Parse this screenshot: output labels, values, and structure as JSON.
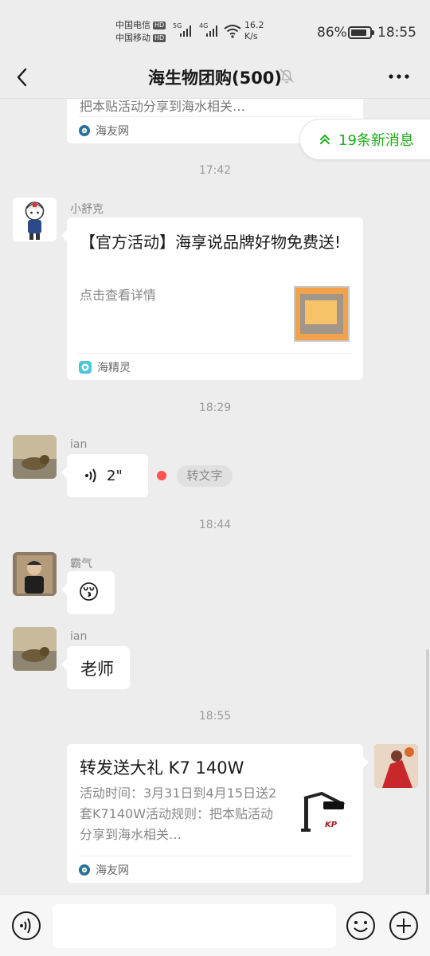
{
  "status_bar": {
    "carrier1": "中国电信",
    "carrier2": "中国移动",
    "hd_badge": "HD",
    "net1": "5G",
    "net2": "4G",
    "speed_value": "16.2",
    "speed_unit": "K/s",
    "battery_percent": "86%",
    "time": "18:55"
  },
  "nav": {
    "title": "海生物团购(500)"
  },
  "new_messages": {
    "label": "19条新消息"
  },
  "messages": {
    "partial_card": {
      "text_cut": "把本贴活动分享到海水相关…",
      "source": "海友网"
    },
    "time1": "17:42",
    "msg1": {
      "sender": "小舒克",
      "title": "【官方活动】海享说品牌好物免费送!",
      "desc": "点击查看详情",
      "source": "海精灵"
    },
    "time2": "18:29",
    "msg2": {
      "sender": "ian",
      "duration": "2\"",
      "to_text": "转文字"
    },
    "time3": "18:44",
    "msg3": {
      "sender": "霸气",
      "emoji": "😚"
    },
    "msg4": {
      "sender": "ian",
      "text": "老师"
    },
    "time4": "18:55",
    "msg5": {
      "title": "转发送大礼 K7 140W",
      "desc": "活动时间：3月31日到4月15日送2套K7140W活动规则：把本贴活动分享到海水相关…",
      "source": "海友网",
      "logo_text": "KP"
    }
  },
  "colors": {
    "accent_green": "#1aad19",
    "unread_dot": "#fa5151",
    "background": "#ededed"
  }
}
